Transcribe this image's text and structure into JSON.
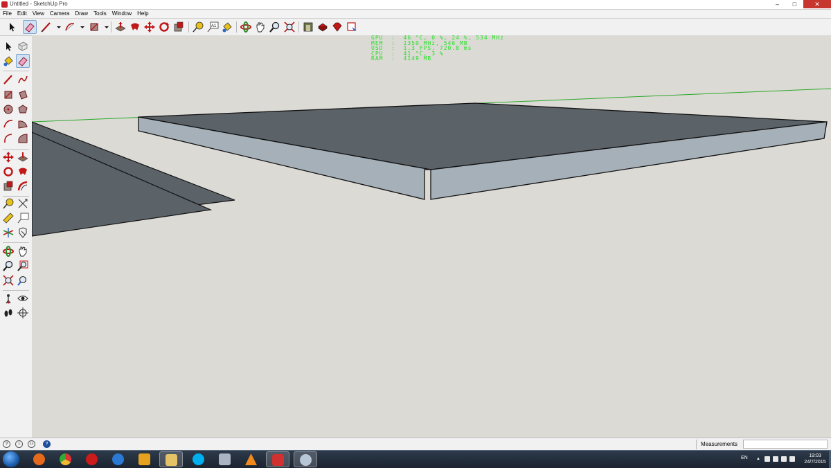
{
  "window": {
    "title": "Untitled - SketchUp Pro",
    "minimize": "–",
    "maximize": "□",
    "close": "✕"
  },
  "menu": [
    "File",
    "Edit",
    "View",
    "Camera",
    "Draw",
    "Tools",
    "Window",
    "Help"
  ],
  "toolbar": {
    "items": [
      {
        "name": "select-tool",
        "icon": "arrow"
      },
      {
        "name": "eraser-tool",
        "icon": "eraser",
        "active": true
      },
      {
        "name": "line-tool",
        "icon": "pencil"
      },
      {
        "name": "line-dropdown",
        "icon": "caret"
      },
      {
        "name": "arc-tool",
        "icon": "arc"
      },
      {
        "name": "arc-dropdown",
        "icon": "caret"
      },
      {
        "name": "rectangle-tool",
        "icon": "rectangle"
      },
      {
        "name": "rectangle-dropdown",
        "icon": "caret"
      },
      {
        "name": "push-pull-tool",
        "icon": "pushpull"
      },
      {
        "name": "follow-me-tool",
        "icon": "followme"
      },
      {
        "name": "move-tool",
        "icon": "move"
      },
      {
        "name": "rotate-tool",
        "icon": "rotate"
      },
      {
        "name": "scale-tool",
        "icon": "scale"
      },
      {
        "name": "tape-measure-tool",
        "icon": "tape"
      },
      {
        "name": "text-tool",
        "icon": "text",
        "label": "A1"
      },
      {
        "name": "paint-bucket-tool",
        "icon": "paint"
      },
      {
        "name": "orbit-tool",
        "icon": "orbit"
      },
      {
        "name": "pan-tool",
        "icon": "hand"
      },
      {
        "name": "zoom-tool",
        "icon": "zoom"
      },
      {
        "name": "zoom-extents-tool",
        "icon": "zoomext"
      },
      {
        "name": "3d-warehouse-button",
        "icon": "warehouse"
      },
      {
        "name": "extension-warehouse-button",
        "icon": "extension"
      },
      {
        "name": "ruby-button",
        "icon": "ruby"
      },
      {
        "name": "layout-button",
        "icon": "layout"
      }
    ]
  },
  "left_tools": [
    "select",
    "component",
    "paint",
    "eraser",
    "line",
    "freehand",
    "rectangle",
    "rotated-rectangle",
    "circle",
    "polygon",
    "arc",
    "pie",
    "2-point-arc",
    "3-point-arc",
    "move",
    "push-pull",
    "rotate",
    "follow-me",
    "scale",
    "offset",
    "tape-measure",
    "dimension",
    "protractor",
    "text",
    "axes",
    "3d-text",
    "orbit",
    "pan",
    "zoom",
    "zoom-window",
    "zoom-extents",
    "previous",
    "position-camera",
    "look-around",
    "walk",
    "section-plane"
  ],
  "hud": {
    "line1": "GPU  :  46 °C, 0 %, 24 %, 534 MHz",
    "line2": "MEM  :  1350 MHz, 546 MB",
    "line3": "OSD  :  1.3 FPS, 720.8 ms",
    "line4": "CPU  :  41 °C, 3 %",
    "line5": "RAM  :  4149 MB"
  },
  "statusbar": {
    "measurements_label": "Measurements",
    "measurements_value": ""
  },
  "taskbar": {
    "apps": [
      {
        "name": "firefox",
        "color": "#e56a1c"
      },
      {
        "name": "chrome",
        "color": "#3a9a3a"
      },
      {
        "name": "opera",
        "color": "#cc1b1b"
      },
      {
        "name": "internet-explorer",
        "color": "#2a7ad4"
      },
      {
        "name": "media-player",
        "color": "#e6a21f"
      },
      {
        "name": "file-explorer",
        "color": "#e3c268"
      },
      {
        "name": "skype",
        "color": "#00aff0"
      },
      {
        "name": "calculator",
        "color": "#a9b3c2"
      },
      {
        "name": "vlc",
        "color": "#f08a1a"
      },
      {
        "name": "sketchup",
        "color": "#d03030"
      },
      {
        "name": "paint-app",
        "color": "#b8c6d6"
      }
    ],
    "language": "EN",
    "time": "19:03",
    "date": "24/7/2015"
  }
}
